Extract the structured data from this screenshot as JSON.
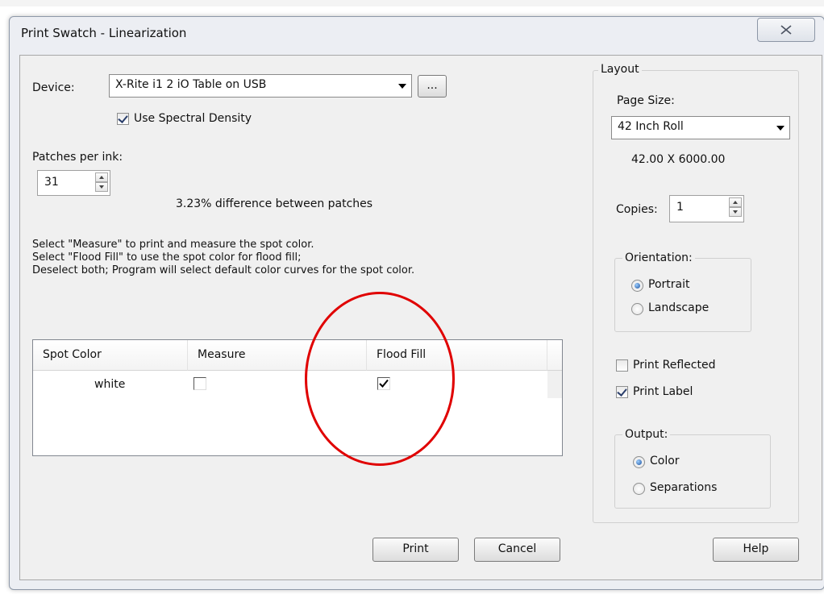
{
  "window": {
    "title": "Print Swatch - Linearization",
    "close_glyph": "✕"
  },
  "device": {
    "label": "Device:",
    "selected": "X-Rite i1 2 iO Table on USB",
    "browse_label": "...",
    "spectral_density_label": "Use Spectral Density",
    "spectral_density_checked": true
  },
  "patches": {
    "label": "Patches per ink:",
    "value": "31",
    "difference_text": "3.23% difference between patches"
  },
  "instructions": [
    "Select \"Measure\" to print and measure the spot color.",
    "Select \"Flood Fill\" to use the spot color for flood fill;",
    "Deselect both; Program will select default color curves for the spot color."
  ],
  "grid": {
    "columns": [
      "Spot Color",
      "Measure",
      "Flood Fill"
    ],
    "rows": [
      {
        "spot_color": "white",
        "measure": false,
        "flood_fill": true
      }
    ]
  },
  "layout": {
    "group_label": "Layout",
    "page_size_label": "Page Size:",
    "page_size_selected": "42 Inch Roll",
    "page_dimensions": "42.00 X 6000.00",
    "copies_label": "Copies:",
    "copies_value": "1",
    "orientation": {
      "label": "Orientation:",
      "options": [
        "Portrait",
        "Landscape"
      ],
      "selected": "Portrait"
    },
    "print_reflected_label": "Print Reflected",
    "print_reflected_checked": false,
    "print_label_label": "Print Label",
    "print_label_checked": true,
    "output": {
      "label": "Output:",
      "options": [
        "Color",
        "Separations"
      ],
      "selected": "Color"
    }
  },
  "buttons": {
    "print": "Print",
    "cancel": "Cancel",
    "help": "Help"
  },
  "colors": {
    "annotation": "#e00000",
    "window_bg": "#f0f0f0"
  }
}
